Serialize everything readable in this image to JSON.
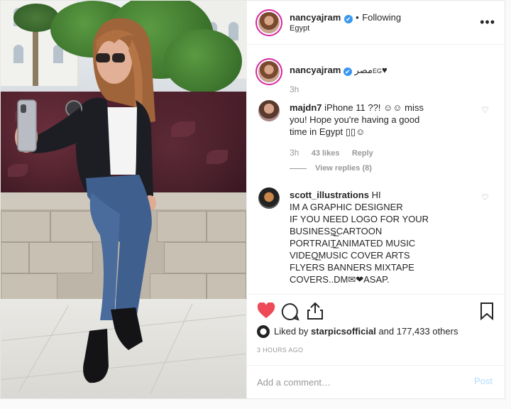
{
  "header": {
    "username": "nancyajram",
    "verified_symbol": "✔",
    "separator": "•",
    "follow_status": "Following",
    "location": "Egypt",
    "more_symbol": "•••"
  },
  "caption": {
    "username": "nancyajram",
    "text": "مصر",
    "flag_text": "EG",
    "heart": "♥",
    "time": "3h"
  },
  "comments": [
    {
      "username": "majdn7",
      "text_line1": "iPhone 11 ??! ☺☺ miss",
      "text_line2": "you! Hope you're having a good",
      "text_line3": "time in Egypt ▯▯☺",
      "time": "3h",
      "likes": "43 likes",
      "reply_label": "Reply",
      "view_replies": "View replies (8)"
    },
    {
      "username": "scott_illustrations",
      "lines": [
        "HI",
        "IM A GRAPHIC DESIGNER",
        "IF YOU NEED LOGO FOR YOUR",
        "BUSINESS̲̲̲CARTOON",
        "PORTRAIT̲̲̲ANIMATED MUSIC",
        "VIDEO̲̲̲MUSIC COVER ARTS",
        "FLYERS BANNERS MIXTAPE",
        "COVERS..DM✉❤ASAP."
      ]
    }
  ],
  "actions": {
    "like_icon": "heart-filled",
    "comment_icon": "comment-bubble",
    "share_icon": "share-arrow",
    "save_icon": "bookmark"
  },
  "likes": {
    "prefix": "Liked by",
    "user": "starpicsofficial",
    "suffix": "and 177,433 others"
  },
  "timestamp": "3 HOURS AGO",
  "add_comment": {
    "placeholder": "Add a comment…",
    "post_label": "Post"
  },
  "colors": {
    "like_red": "#ed4956",
    "verified_blue": "#3897f0",
    "post_disabled": "#b3dbff"
  }
}
